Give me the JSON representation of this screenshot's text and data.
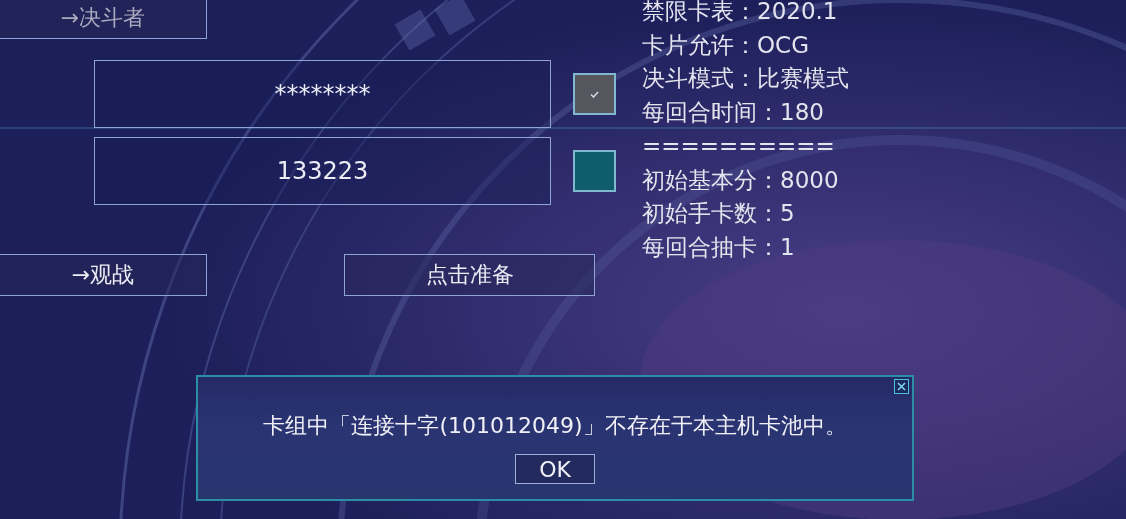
{
  "duelist_button": {
    "label": "→决斗者",
    "disabled": true
  },
  "fields": [
    {
      "value": "********",
      "checked": true
    },
    {
      "value": "133223",
      "checked": false
    }
  ],
  "spectate_button": {
    "label": "→观战",
    "disabled": false
  },
  "ready_button": {
    "label": "点击准备"
  },
  "room_info": [
    "禁限卡表：2020.1",
    "卡片允许：OCG",
    "决斗模式：比赛模式",
    "每回合时间：180",
    "==========",
    "初始基本分：8000",
    "初始手卡数：5",
    "每回合抽卡：1"
  ],
  "dialog": {
    "message": "卡组中「连接十字(101012049)」不存在于本主机卡池中。",
    "ok_button": "OK"
  }
}
